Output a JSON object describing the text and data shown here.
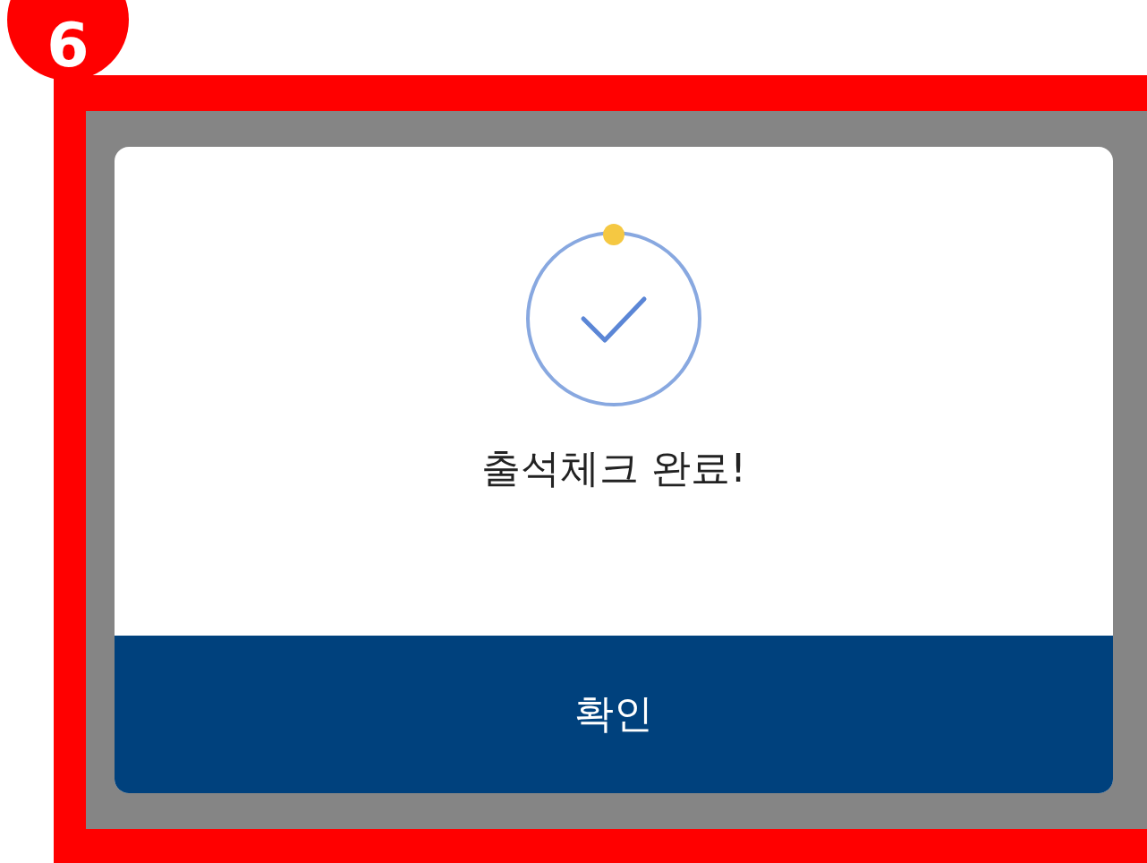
{
  "annotation": {
    "label": "6"
  },
  "dialog": {
    "message": "출석체크 완료!",
    "button": "확인"
  }
}
